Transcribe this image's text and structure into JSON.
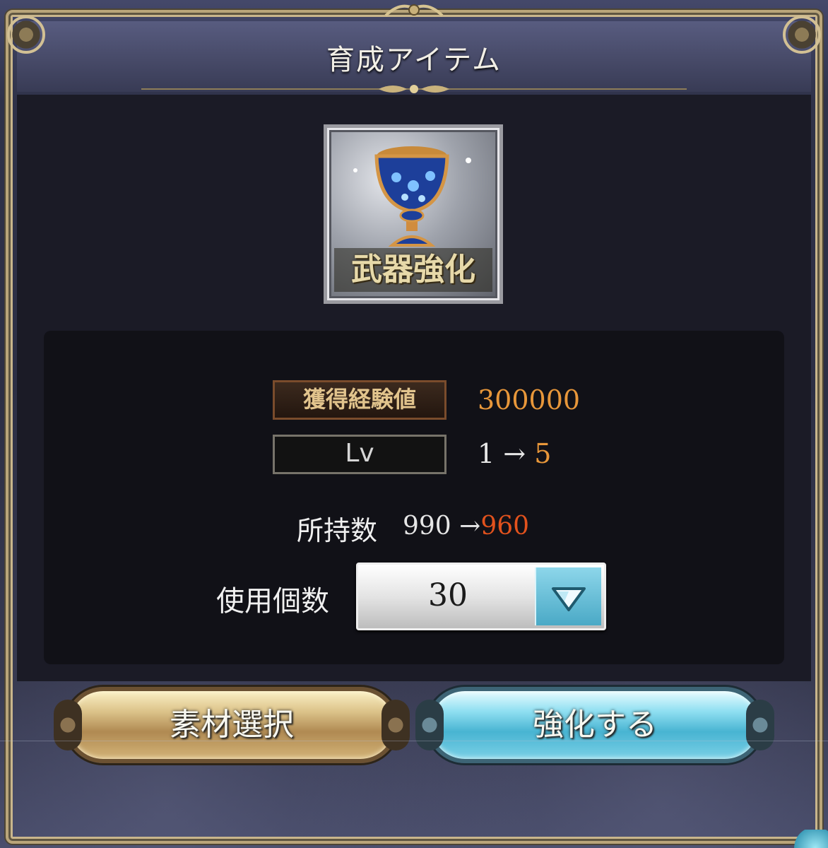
{
  "dialog": {
    "title": "育成アイテム"
  },
  "item": {
    "caption": "武器強化",
    "icon": "chalice-icon"
  },
  "stats": {
    "exp_label": "獲得経験値",
    "exp_value": "300000",
    "lv_label": "Lv",
    "lv_from": "1",
    "lv_arrow": "→",
    "lv_to": "5"
  },
  "owned": {
    "label": "所持数",
    "from": "990",
    "arrow": "→",
    "to": "960"
  },
  "usage": {
    "label": "使用個数",
    "selected_value": "30"
  },
  "buttons": {
    "material_label": "素材選択",
    "enhance_label": "強化する"
  },
  "colors": {
    "accent_orange": "#e8973a",
    "accent_red": "#e2521d",
    "frame_gold": "#b9a57a",
    "enhance_blue": "#48b4d2"
  }
}
